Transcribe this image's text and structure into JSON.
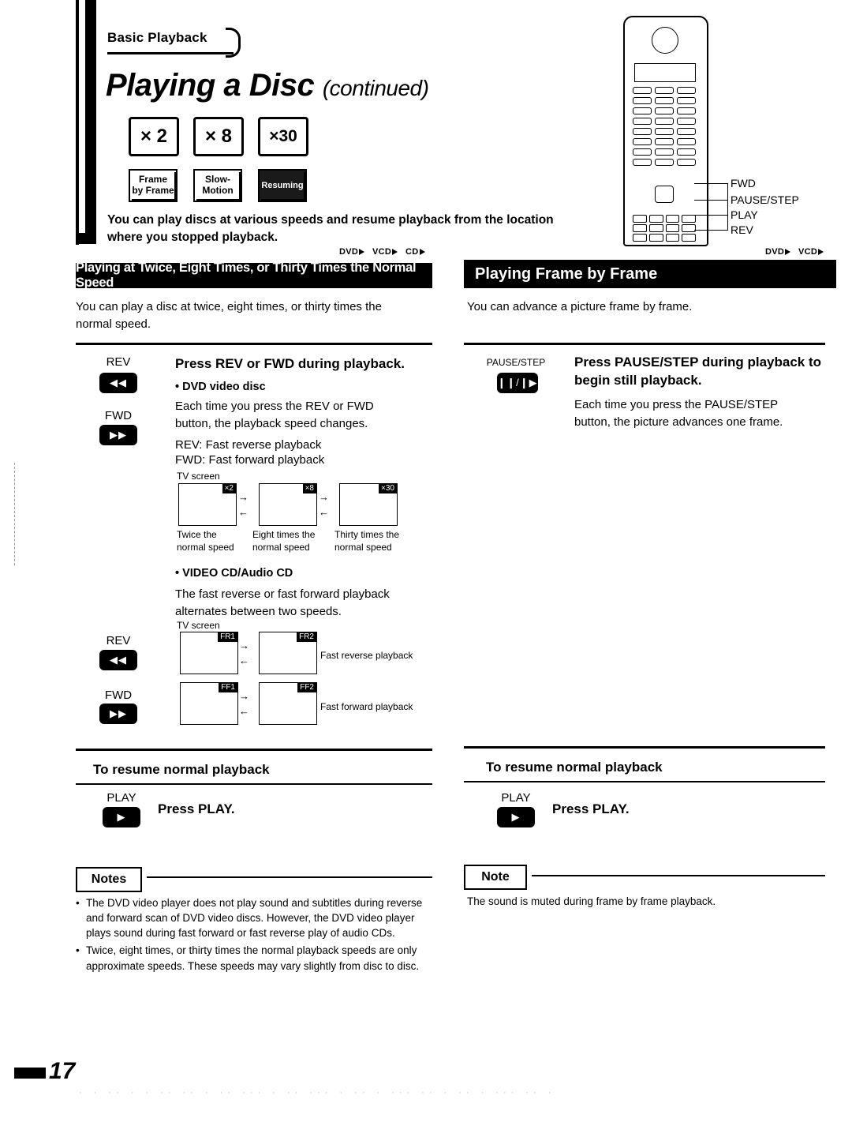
{
  "header": {
    "chapter_tag": "Basic Playback",
    "title": "Playing a Disc",
    "title_continued": "(continued)",
    "speed_boxes": [
      {
        "icon": "× 2",
        "label": "Frame\nby Frame"
      },
      {
        "icon": "× 8",
        "label": "Slow-\nMotion"
      },
      {
        "icon": "×30",
        "label": "Resuming"
      }
    ],
    "speed_labels": [
      "Frame by Frame",
      "Slow- Motion",
      "Resuming"
    ],
    "intro": "You can play discs at various speeds and resume playback from the location where you stopped playback."
  },
  "remote": {
    "callouts": [
      "FWD",
      "PAUSE/STEP",
      "PLAY",
      "REV"
    ]
  },
  "left_column": {
    "disc_tags": [
      "DVD",
      "VCD",
      "CD"
    ],
    "section_title": "Playing at Twice, Eight Times, or Thirty Times the Normal Speed",
    "intro": "You can play a disc at twice, eight times, or thirty times the normal speed.",
    "keys": [
      {
        "label": "REV",
        "glyph": "◀◀"
      },
      {
        "label": "FWD",
        "glyph": "▶▶"
      }
    ],
    "instruction": "Press REV or FWD during playback.",
    "dvd_bullet": "• DVD video disc",
    "dvd_text": "Each time you press the REV or FWD button, the playback speed changes.",
    "rev_def": "REV:   Fast reverse playback",
    "fwd_def": "FWD:   Fast forward playback",
    "tv_screen_label": "TV screen",
    "speed_diagram": {
      "boxes": [
        "×2",
        "×8",
        "×30"
      ],
      "captions": [
        "Twice the normal speed",
        "Eight times the normal speed",
        "Thirty times the normal speed"
      ]
    },
    "vcd_bullet": "• VIDEO CD/Audio CD",
    "vcd_text": "The fast reverse or fast forward playback alternates between two speeds.",
    "tv_screen_label2": "TV screen",
    "alt_diagram": {
      "rev_label": "REV",
      "fwd_label": "FWD",
      "rev_boxes": [
        "FR1",
        "FR2"
      ],
      "fwd_boxes": [
        "FF1",
        "FF2"
      ],
      "rev_caption": "Fast reverse playback",
      "fwd_caption": "Fast forward playback"
    },
    "resume_title": "To resume normal playback",
    "resume_key_label": "PLAY",
    "resume_key_glyph": "▶",
    "resume_instruction": "Press PLAY.",
    "notes_tab": "Notes",
    "notes": [
      "The DVD video player does not play sound and subtitles during reverse and forward scan of DVD video discs. However, the DVD video player plays sound during fast forward or fast reverse play of audio CDs.",
      "Twice, eight times, or thirty times the normal playback speeds are only approximate speeds. These speeds may vary slightly from disc to disc."
    ]
  },
  "right_column": {
    "disc_tags": [
      "DVD",
      "VCD"
    ],
    "section_title": "Playing Frame by Frame",
    "intro": "You can advance a picture frame by frame.",
    "key_label": "PAUSE/STEP",
    "key_glyph": "❙❙/❙▶",
    "instruction": "Press PAUSE/STEP during playback to begin still playback.",
    "body": "Each time you press the PAUSE/STEP button, the picture advances one frame.",
    "resume_title": "To resume normal playback",
    "resume_key_label": "PLAY",
    "resume_key_glyph": "▶",
    "resume_instruction": "Press PLAY.",
    "note_tab": "Note",
    "note": "The sound is muted during frame by frame playback."
  },
  "footer": {
    "page_number": "17"
  }
}
